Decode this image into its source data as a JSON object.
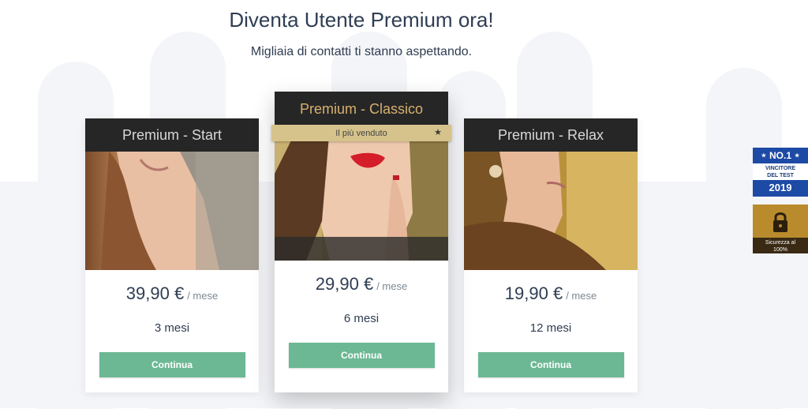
{
  "hero": {
    "title": "Diventa Utente Premium ora!",
    "subtitle": "Migliaia di contatti ti stanno aspettando."
  },
  "plans": [
    {
      "name": "Premium - Start",
      "price": "39,90 €",
      "per": "/ mese",
      "duration": "3 mesi",
      "button": "Continua"
    },
    {
      "name": "Premium - Classico",
      "ribbon": "Il più venduto",
      "price": "29,90 €",
      "per": "/ mese",
      "duration": "6 mesi",
      "button": "Continua"
    },
    {
      "name": "Premium - Relax",
      "price": "19,90 €",
      "per": "/ mese",
      "duration": "12 mesi",
      "button": "Continua"
    }
  ],
  "badges": {
    "test": {
      "top": "NO.1",
      "middle_line1": "VINCITORE",
      "middle_line2": "DEL TEST",
      "year": "2019"
    },
    "secure": {
      "line1": "Sicurezza al",
      "line2": "100%"
    }
  },
  "colors": {
    "button": "#6cb894",
    "card_header": "#262626",
    "featured_title": "#d7b16e",
    "ribbon": "#d6c38b",
    "badge_blue": "#1d4aa5",
    "badge_gold": "#b98b2c"
  },
  "icons": {
    "ribbon": "star-icon",
    "secure_badge": "padlock-icon"
  }
}
